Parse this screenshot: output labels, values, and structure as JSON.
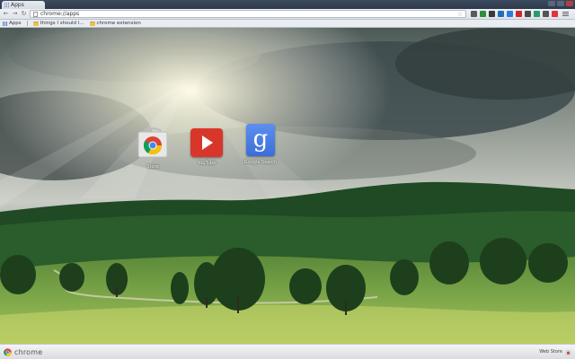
{
  "window": {
    "tab_title": "Apps",
    "controls": [
      "minimize",
      "maximize",
      "close"
    ]
  },
  "toolbar": {
    "back_icon": "back-arrow-icon",
    "forward_icon": "forward-arrow-icon",
    "reload_icon": "reload-icon",
    "url": "chrome://apps",
    "bookmark_icon": "star-icon",
    "extensions": [
      {
        "name": "ext-1",
        "color": "#5a5a5a"
      },
      {
        "name": "ext-2",
        "color": "#2f8f3a"
      },
      {
        "name": "ext-3",
        "color": "#3a3a3a"
      },
      {
        "name": "ext-4",
        "color": "#1f6fb8"
      },
      {
        "name": "ext-5",
        "color": "#2b7de0"
      },
      {
        "name": "ext-6",
        "color": "#cc2a2a"
      },
      {
        "name": "ext-7",
        "color": "#4a4a4a"
      },
      {
        "name": "ext-8",
        "color": "#2a9b6c"
      },
      {
        "name": "ext-9",
        "color": "#555555"
      },
      {
        "name": "ext-10",
        "color": "#e0353a"
      }
    ],
    "menu_icon": "hamburger-menu-icon"
  },
  "bookmarks": {
    "apps_label": "Apps",
    "items": [
      {
        "label": "things I should l...",
        "icon": "folder-icon"
      },
      {
        "label": "chrome extension",
        "icon": "folder-icon"
      }
    ]
  },
  "apps": [
    {
      "label": "Store",
      "icon": "chrome-web-store-icon"
    },
    {
      "label": "YouTube",
      "icon": "youtube-icon"
    },
    {
      "label": "Google Search",
      "icon": "google-search-icon"
    }
  ],
  "bottom_bar": {
    "brand": "chrome",
    "webstore_label": "Web Store"
  }
}
